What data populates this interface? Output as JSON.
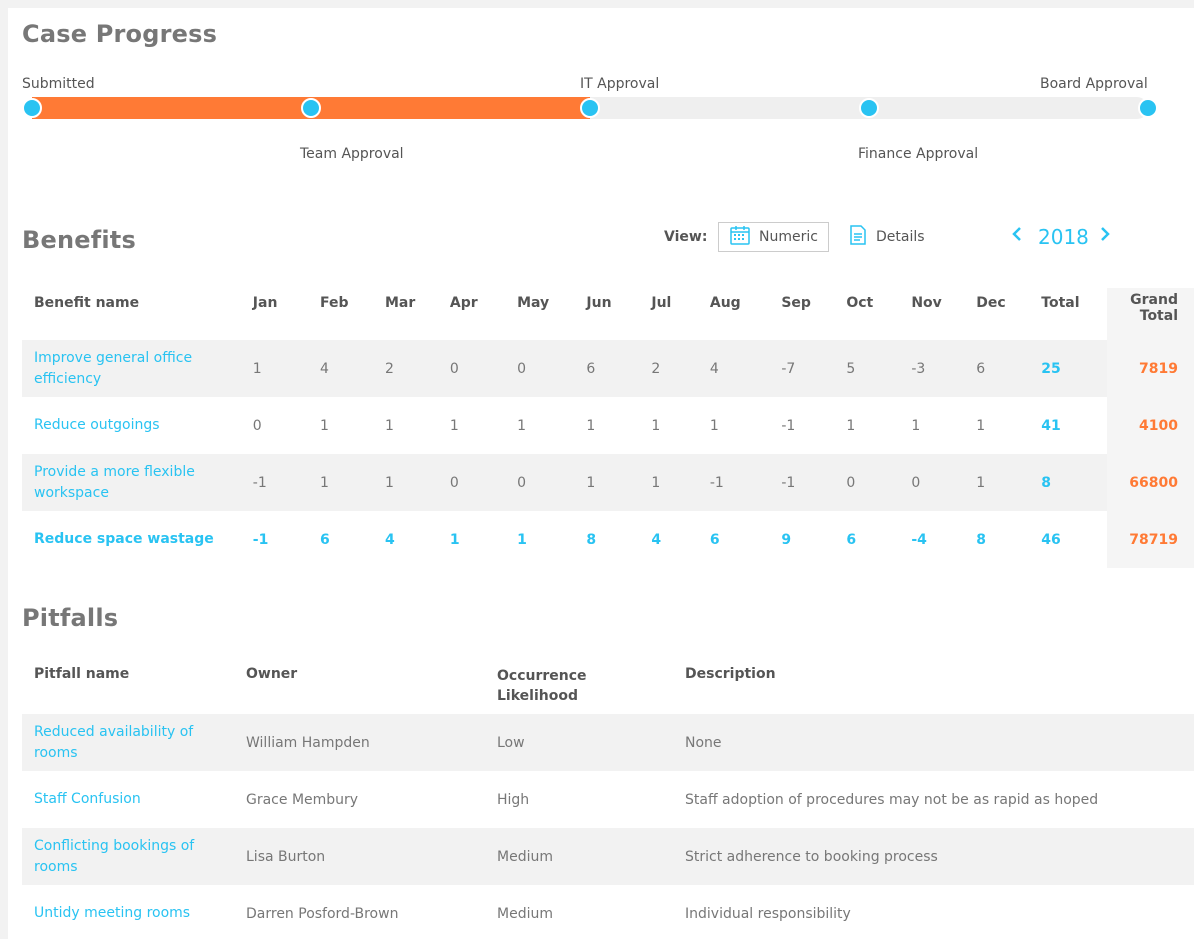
{
  "case_progress": {
    "title": "Case Progress",
    "stages": [
      {
        "label": "Submitted",
        "position": "above"
      },
      {
        "label": "Team Approval",
        "position": "below"
      },
      {
        "label": "IT Approval",
        "position": "above"
      },
      {
        "label": "Finance Approval",
        "position": "below"
      },
      {
        "label": "Board Approval",
        "position": "above"
      }
    ],
    "completed_fraction": 0.5,
    "colors": {
      "fill": "#ff7a35",
      "dot": "#29c3f2",
      "track": "#efefef"
    }
  },
  "benefits": {
    "title": "Benefits",
    "view_label": "View:",
    "view_numeric": "Numeric",
    "view_details": "Details",
    "year": "2018",
    "columns": [
      "Benefit name",
      "Jan",
      "Feb",
      "Mar",
      "Apr",
      "May",
      "Jun",
      "Jul",
      "Aug",
      "Sep",
      "Oct",
      "Nov",
      "Dec",
      "Total"
    ],
    "grand_total_header_1": "Grand",
    "grand_total_header_2": "Total",
    "rows": [
      {
        "name_1": "Improve general office",
        "name_2": "efficiency",
        "values": [
          "1",
          "4",
          "2",
          "0",
          "0",
          "6",
          "2",
          "4",
          "-7",
          "5",
          "-3",
          "6"
        ],
        "total": "25",
        "grand_total": "7819"
      },
      {
        "name_1": "Reduce outgoings",
        "name_2": "",
        "values": [
          "0",
          "1",
          "1",
          "1",
          "1",
          "1",
          "1",
          "1",
          "-1",
          "1",
          "1",
          "1"
        ],
        "total": "41",
        "grand_total": "4100"
      },
      {
        "name_1": "Provide a more flexible",
        "name_2": "workspace",
        "values": [
          "-1",
          "1",
          "1",
          "0",
          "0",
          "1",
          "1",
          "-1",
          "-1",
          "0",
          "0",
          "1"
        ],
        "total": "8",
        "grand_total": "66800"
      },
      {
        "name_1": "Reduce space wastage",
        "name_2": "",
        "values": [
          "-1",
          "6",
          "4",
          "1",
          "1",
          "8",
          "4",
          "6",
          "9",
          "6",
          "-4",
          "8"
        ],
        "total": "46",
        "grand_total": "78719"
      }
    ]
  },
  "pitfalls": {
    "title": "Pitfalls",
    "columns": {
      "name": "Pitfall name",
      "owner": "Owner",
      "likelihood_1": "Occurrence",
      "likelihood_2": "Likelihood",
      "description": "Description"
    },
    "rows": [
      {
        "name_1": "Reduced availability of",
        "name_2": "rooms",
        "owner": "William Hampden",
        "likelihood": "Low",
        "description": "None"
      },
      {
        "name_1": "Staff Confusion",
        "name_2": "",
        "owner": "Grace Membury",
        "likelihood": "High",
        "description": "Staff adoption of procedures may not be as rapid as hoped"
      },
      {
        "name_1": "Conflicting bookings of",
        "name_2": "rooms",
        "owner": "Lisa Burton",
        "likelihood": "Medium",
        "description": "Strict adherence to booking process"
      },
      {
        "name_1": "Untidy meeting rooms",
        "name_2": "",
        "owner": "Darren Posford-Brown",
        "likelihood": "Medium",
        "description": "Individual responsibility"
      }
    ]
  }
}
